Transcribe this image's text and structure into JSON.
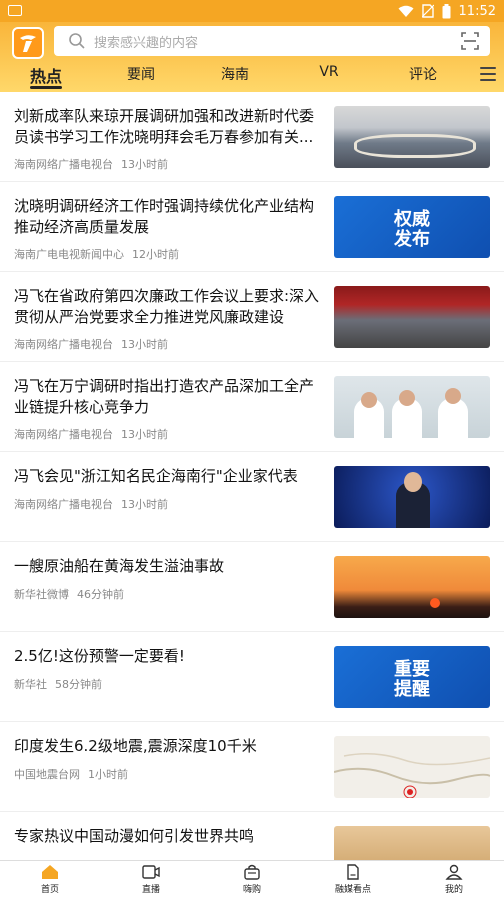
{
  "status_bar": {
    "time": "11:52"
  },
  "search": {
    "placeholder": "搜索感兴趣的内容"
  },
  "tabs": [
    {
      "label": "热点",
      "active": true
    },
    {
      "label": "要闻"
    },
    {
      "label": "海南"
    },
    {
      "label": "VR"
    },
    {
      "label": "评论"
    }
  ],
  "news": [
    {
      "title": "刘新成率队来琼开展调研加强和改进新时代委员读书学习工作沈晓明拜会毛万春参加有关...",
      "source": "海南网络广播电视台",
      "time": "13小时前",
      "thumb": "meeting-room-photo"
    },
    {
      "title": "沈晓明调研经济工作时强调持续优化产业结构推动经济高质量发展",
      "source": "海南广电电视新闻中心",
      "time": "12小时前",
      "thumb_text": "权威\n发布"
    },
    {
      "title": "冯飞在省政府第四次廉政工作会议上要求:深入贯彻从严治党要求全力推进党风廉政建设",
      "source": "海南网络广播电视台",
      "time": "13小时前",
      "thumb": "conference-hall-photo"
    },
    {
      "title": "冯飞在万宁调研时指出打造农产品深加工全产业链提升核心竞争力",
      "source": "海南网络广播电视台",
      "time": "13小时前",
      "thumb": "officials-photo"
    },
    {
      "title": "冯飞会见\"浙江知名民企海南行\"企业家代表",
      "source": "海南网络广播电视台",
      "time": "13小时前",
      "thumb": "news-anchor-photo"
    },
    {
      "title": "一艘原油船在黄海发生溢油事故",
      "source": "新华社微博",
      "time": "46分钟前",
      "thumb": "sunset-sea-photo"
    },
    {
      "title": "2.5亿!这份预警一定要看!",
      "source": "新华社",
      "time": "58分钟前",
      "thumb_text": "重要\n提醒"
    },
    {
      "title": "印度发生6.2级地震,震源深度10千米",
      "source": "中国地震台网",
      "time": "1小时前",
      "thumb": "map-image"
    },
    {
      "title": "专家热议中国动漫如何引发世界共鸣",
      "source": "",
      "time": "",
      "thumb": "anime-photo"
    }
  ],
  "bottom_nav": [
    {
      "label": "首页",
      "icon": "home-icon",
      "active": true
    },
    {
      "label": "直播",
      "icon": "live-icon"
    },
    {
      "label": "嗨购",
      "icon": "shopping-bag-icon"
    },
    {
      "label": "融媒看点",
      "icon": "document-icon"
    },
    {
      "label": "我的",
      "icon": "profile-icon"
    }
  ],
  "colors": {
    "brand": "#f5a623",
    "active_nav": "#f5a623"
  }
}
